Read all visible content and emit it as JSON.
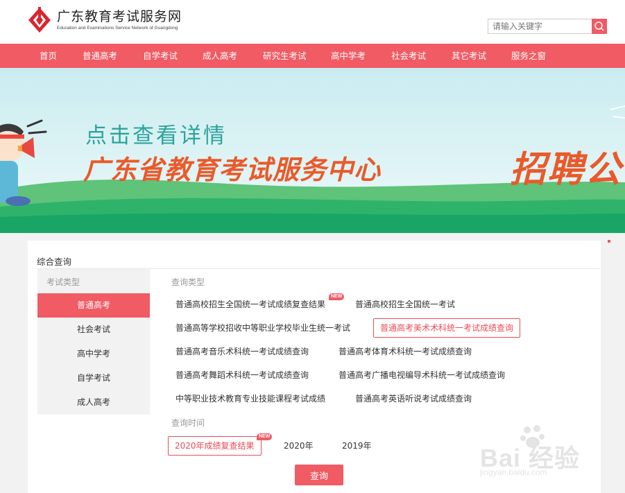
{
  "header": {
    "site_title": "广东教育考试服务网",
    "site_subtitle": "Education and Examinations Service Network of Guangdong",
    "search_placeholder": "请输入关键字",
    "brand_color": "#f05b64"
  },
  "nav": {
    "items": [
      "首页",
      "普通高考",
      "自学考试",
      "成人高考",
      "研究生考试",
      "高中学考",
      "社会考试",
      "其它考试",
      "服务之窗"
    ]
  },
  "banner": {
    "line1": "点击查看详情",
    "line2": "广东省教育考试服务中心",
    "line3": "招聘公"
  },
  "query": {
    "title": "综合查询",
    "sidebar_title": "考试类型",
    "sidebar_items": [
      "普通高考",
      "社会考试",
      "高中学考",
      "自学考试",
      "成人高考"
    ],
    "active_sidebar": "普通高考",
    "type_label": "查询类型",
    "types": [
      "普通高校招生全国统一考试成绩复查结果",
      "普通高校招生全国统一考试",
      "普通高等学校招收中等职业学校毕业生统一考试",
      "普通高考美术术科统一考试成绩查询",
      "普通高考音乐术科统一考试成绩查询",
      "普通高考体育术科统一考试成绩查询",
      "普通高考舞蹈术科统一考试成绩查询",
      "普通高考广播电视编导术科统一考试成绩查询",
      "中等职业技术教育专业技能课程考试成绩",
      "普通高考英语听说考试成绩查询"
    ],
    "selected_type": "普通高考美术术科统一考试成绩查询",
    "time_label": "查询时间",
    "times": [
      "2020年成绩复查结果",
      "2020年",
      "2019年"
    ],
    "selected_time": "2020年成绩复查结果",
    "new_badge": "NEW",
    "submit_label": "查询"
  },
  "watermark": {
    "text": "Bai 经验",
    "url": "jingyan.baidu.com"
  }
}
